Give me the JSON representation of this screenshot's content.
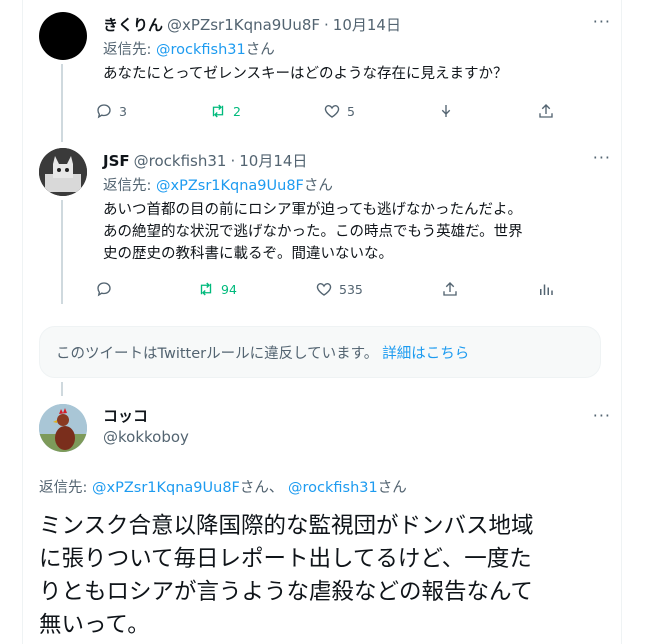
{
  "tweets": [
    {
      "name": "きくりん",
      "handle": "@xPZsr1Kqna9Uu8F",
      "sep": "·",
      "date": "10月14日",
      "reply_prefix": "返信先:",
      "reply_to": "@rockfish31",
      "reply_suffix": "さん",
      "text_lines": [
        "あなたにとってゼレンスキーはどのような存在に見えますか？"
      ],
      "counts": {
        "reply": "3",
        "retweet": "2",
        "like": "5"
      }
    },
    {
      "name": "JSF",
      "handle": "@rockfish31",
      "sep": "·",
      "date": "10月14日",
      "reply_prefix": "返信先:",
      "reply_to": "@xPZsr1Kqna9Uu8F",
      "reply_suffix": "さん",
      "text_lines": [
        "あいつ首都の目の前にロシア軍が迫っても逃げなかったんだよ。",
        "あの絶望的な状況で逃げなかった。この時点でもう英雄だ。世界",
        "史の歴史の教科書に載るぞ。間違いないな。"
      ],
      "counts": {
        "reply": "",
        "retweet": "94",
        "like": "535"
      }
    }
  ],
  "notice": {
    "text": "このツイートはTwitterルールに違反しています。",
    "link": "詳細はこちら"
  },
  "main": {
    "name": "コッコ",
    "handle": "@kokkoboy",
    "reply_prefix": "返信先:",
    "reply_to_1": "@xPZsr1Kqna9Uu8F",
    "reply_mid": "さん、",
    "reply_to_2": "@rockfish31",
    "reply_suffix": "さん",
    "text_lines": [
      "ミンスク合意以降国際的な監視団がドンバス地域",
      "に張りついて毎日レポート出してるけど、一度た",
      "りともロシアが言うような虐殺などの報告なんて",
      "無いって。"
    ]
  },
  "more_glyph": "···",
  "colors": {
    "link": "#1d9bf0",
    "retweet": "#00ba7c",
    "muted": "#536471"
  },
  "icons": [
    "reply-icon",
    "retweet-icon",
    "like-icon",
    "download-icon",
    "share-icon",
    "analytics-icon",
    "more-icon"
  ]
}
